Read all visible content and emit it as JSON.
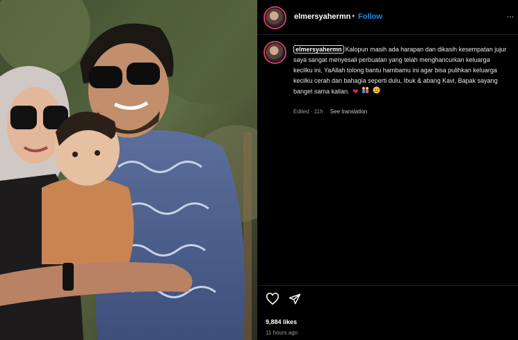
{
  "post": {
    "author": "elmersyahermn",
    "separator": "•",
    "follow_label": "Follow",
    "more_label": "...",
    "caption_text": "Kalopun masih ada harapan dan dikasih kesempatan jujur saya sangat menyesali perbuatan yang telah menghancurkan keluarga kecilku ini, YaAllah tolong bantu hambamu ini agar bisa pulihkan keluarga kecilku cerah dan bahagia seperti dulu, Ibuk & abang Kavi, Bapak sayang banget sama kalian.",
    "caption_emojis": [
      "red-heart",
      "family",
      "smiling-face"
    ],
    "edited_label": "Edited · 11h",
    "translation_label": "See translation",
    "likes": "9,884 likes",
    "timestamp": "11 hours ago"
  },
  "icons": {
    "like": "heart-outline-icon",
    "share": "paper-plane-icon",
    "more": "ellipsis-icon"
  },
  "colors": {
    "background": "#000000",
    "follow": "#1d8ce6",
    "story_ring": "#d63d6c",
    "heart": "#e0245e",
    "muted": "#9a9a9a"
  }
}
